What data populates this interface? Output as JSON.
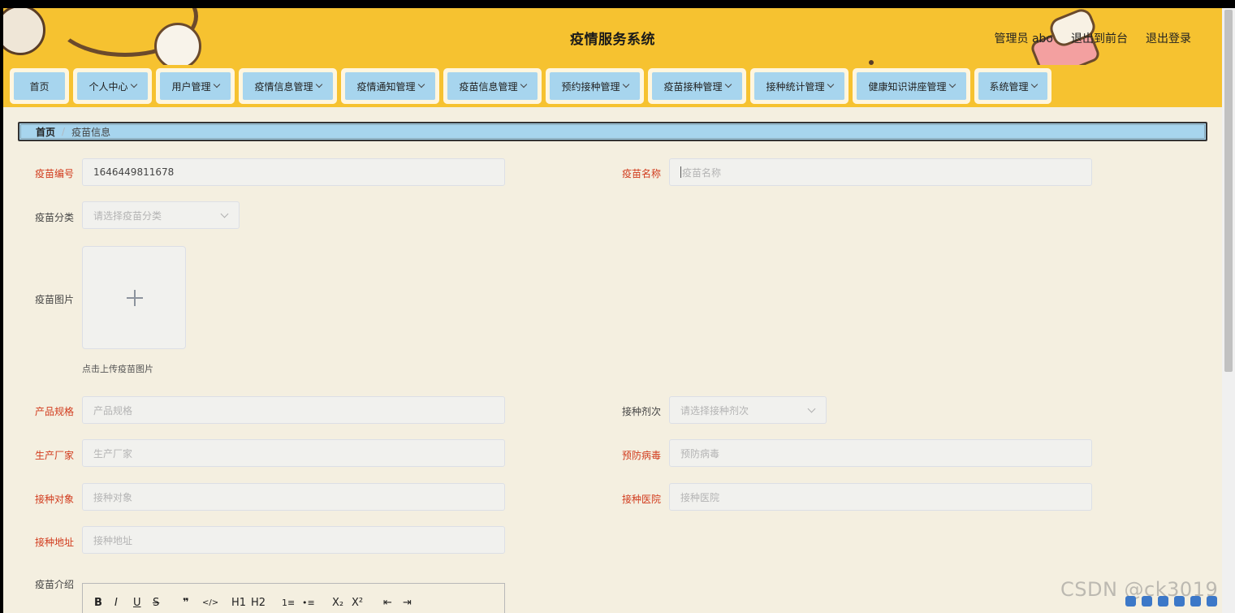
{
  "header": {
    "title": "疫情服务系统",
    "admin_label": "管理员 abo",
    "back_to_front": "退出到前台",
    "logout": "退出登录"
  },
  "nav": {
    "items": [
      {
        "label": "首页",
        "has_dropdown": false
      },
      {
        "label": "个人中心",
        "has_dropdown": true
      },
      {
        "label": "用户管理",
        "has_dropdown": true
      },
      {
        "label": "疫情信息管理",
        "has_dropdown": true
      },
      {
        "label": "疫情通知管理",
        "has_dropdown": true
      },
      {
        "label": "疫苗信息管理",
        "has_dropdown": true
      },
      {
        "label": "预约接种管理",
        "has_dropdown": true
      },
      {
        "label": "疫苗接种管理",
        "has_dropdown": true
      },
      {
        "label": "接种统计管理",
        "has_dropdown": true
      },
      {
        "label": "健康知识讲座管理",
        "has_dropdown": true
      },
      {
        "label": "系统管理",
        "has_dropdown": true
      }
    ]
  },
  "breadcrumb": {
    "home": "首页",
    "separator": "/",
    "current": "疫苗信息"
  },
  "form": {
    "vaccine_no": {
      "label": "疫苗编号",
      "value": "1646449811678"
    },
    "vaccine_name": {
      "label": "疫苗名称",
      "placeholder": "疫苗名称"
    },
    "category": {
      "label": "疫苗分类",
      "placeholder": "请选择疫苗分类"
    },
    "image": {
      "label": "疫苗图片",
      "tip": "点击上传疫苗图片"
    },
    "spec": {
      "label": "产品规格",
      "placeholder": "产品规格"
    },
    "dose": {
      "label": "接种剂次",
      "placeholder": "请选择接种剂次"
    },
    "manufacturer": {
      "label": "生产厂家",
      "placeholder": "生产厂家"
    },
    "virus": {
      "label": "预防病毒",
      "placeholder": "预防病毒"
    },
    "target": {
      "label": "接种对象",
      "placeholder": "接种对象"
    },
    "hospital": {
      "label": "接种医院",
      "placeholder": "接种医院"
    },
    "address": {
      "label": "接种地址",
      "placeholder": "接种地址"
    },
    "intro": {
      "label": "疫苗介绍"
    }
  },
  "editor_toolbar": {
    "bold": "B",
    "italic": "I",
    "underline": "U",
    "strike": "S",
    "quote": "❞",
    "code": "</>",
    "h1": "H1",
    "h2": "H2",
    "ordered_list": "1≡",
    "bullet_list": "•≡",
    "subscript": "X₂",
    "superscript": "X²",
    "outdent": "⇤",
    "indent": "⇥"
  },
  "watermark": "CSDN @ck3019",
  "colors": {
    "header_bg": "#f6c230",
    "nav_pill": "#a7d5ee",
    "page_bg": "#f4efe0",
    "required_label": "#d13b1d"
  }
}
